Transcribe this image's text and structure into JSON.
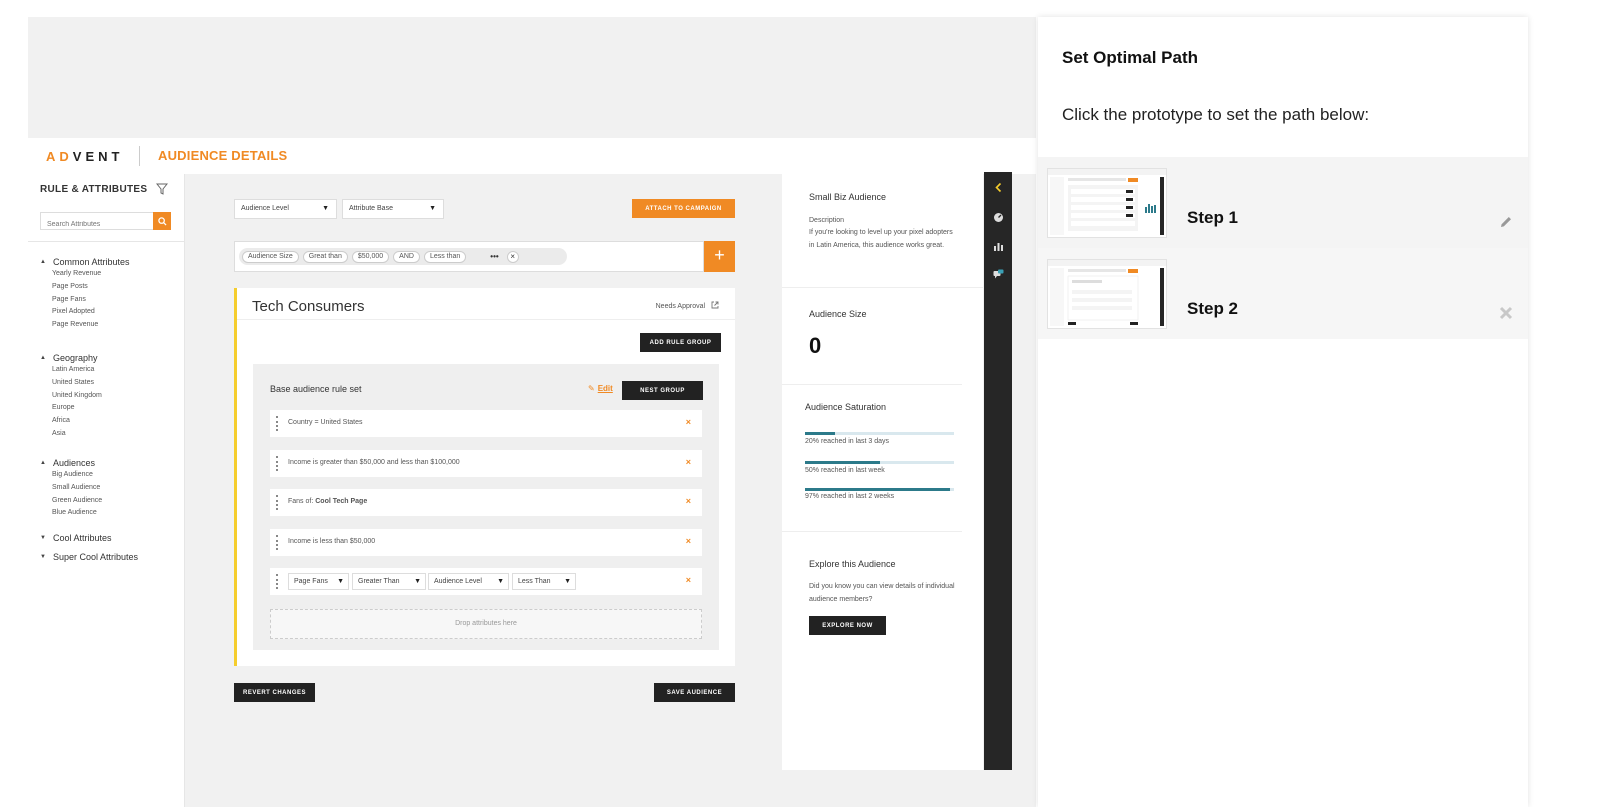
{
  "app": {
    "logo_prefix": "AD",
    "logo_suffix": "VENT",
    "page_title": "AUDIENCE DETAILS"
  },
  "sidebar": {
    "title": "RULE & ATTRIBUTES",
    "search_placeholder": "Search Attributes",
    "groups": [
      {
        "label": "Common Attributes",
        "expanded": true,
        "items": [
          "Yearly Revenue",
          "Page Posts",
          "Page Fans",
          "Pixel Adopted",
          "Page Revenue"
        ]
      },
      {
        "label": "Geography",
        "expanded": true,
        "items": [
          "Latin America",
          "United States",
          "United Kingdom",
          "Europe",
          "Africa",
          "Asia"
        ]
      },
      {
        "label": "Audiences",
        "expanded": true,
        "items": [
          "Big Audience",
          "Small Audience",
          "Green Audience",
          "Blue Audience"
        ]
      },
      {
        "label": "Cool Attributes",
        "expanded": false,
        "items": []
      },
      {
        "label": "Super Cool Attributes",
        "expanded": false,
        "items": []
      }
    ]
  },
  "toolbar": {
    "audience_level": "Audience Level",
    "attribute_base": "Attribute Base",
    "attach_label": "ATTACH TO CAMPAIGN"
  },
  "chips": {
    "items": [
      "Audience Size",
      "Great than",
      "$50,000",
      "AND",
      "Less than"
    ],
    "more": "•••",
    "clear": "×",
    "add": "+"
  },
  "card": {
    "title": "Tech Consumers",
    "status": "Needs Approval",
    "add_rule_group": "ADD RULE GROUP",
    "ruleset_title": "Base audience rule set",
    "edit_label": "Edit",
    "nest_group": "NEST GROUP",
    "rules": [
      {
        "text": "Country = United States"
      },
      {
        "text": "Income is greater than $50,000 and less than $100,000"
      },
      {
        "prefix": "Fans of: ",
        "bold": "Cool Tech Page"
      },
      {
        "text": "Income is less than $50,000"
      }
    ],
    "builder": [
      "Page Fans",
      "Greater Than",
      "Audience Level",
      "Less Than"
    ],
    "remove_glyph": "×",
    "drop_text": "Drop attributes here",
    "revert": "REVERT CHANGES",
    "save": "SAVE AUDIENCE"
  },
  "info": {
    "name": "Small Biz Audience",
    "desc_label": "Description",
    "desc": "If you're looking to level up your pixel adopters in Latin America, this audience works great.",
    "size_label": "Audience Size",
    "size_value": "0",
    "saturation_label": "Audience Saturation",
    "saturation": [
      {
        "label": "20% reached in last 3 days",
        "pct": 20
      },
      {
        "label": "50% reached in last week",
        "pct": 50
      },
      {
        "label": "97% reached in last 2 weeks",
        "pct": 97
      }
    ],
    "explore_title": "Explore this Audience",
    "explore_text": "Did you know you can view details of individual audience members?",
    "explore_btn": "EXPLORE NOW"
  },
  "panel": {
    "title": "Set Optimal Path",
    "subtitle": "Click the prototype to set the path below:",
    "steps": [
      {
        "label": "Step 1",
        "action_icon": "pencil-icon"
      },
      {
        "label": "Step 2",
        "action_icon": "close-icon"
      }
    ]
  },
  "colors": {
    "accent": "#f08a24",
    "highlight": "#f5cd2d",
    "bar": "#2c7a8a",
    "dark": "#262626"
  }
}
